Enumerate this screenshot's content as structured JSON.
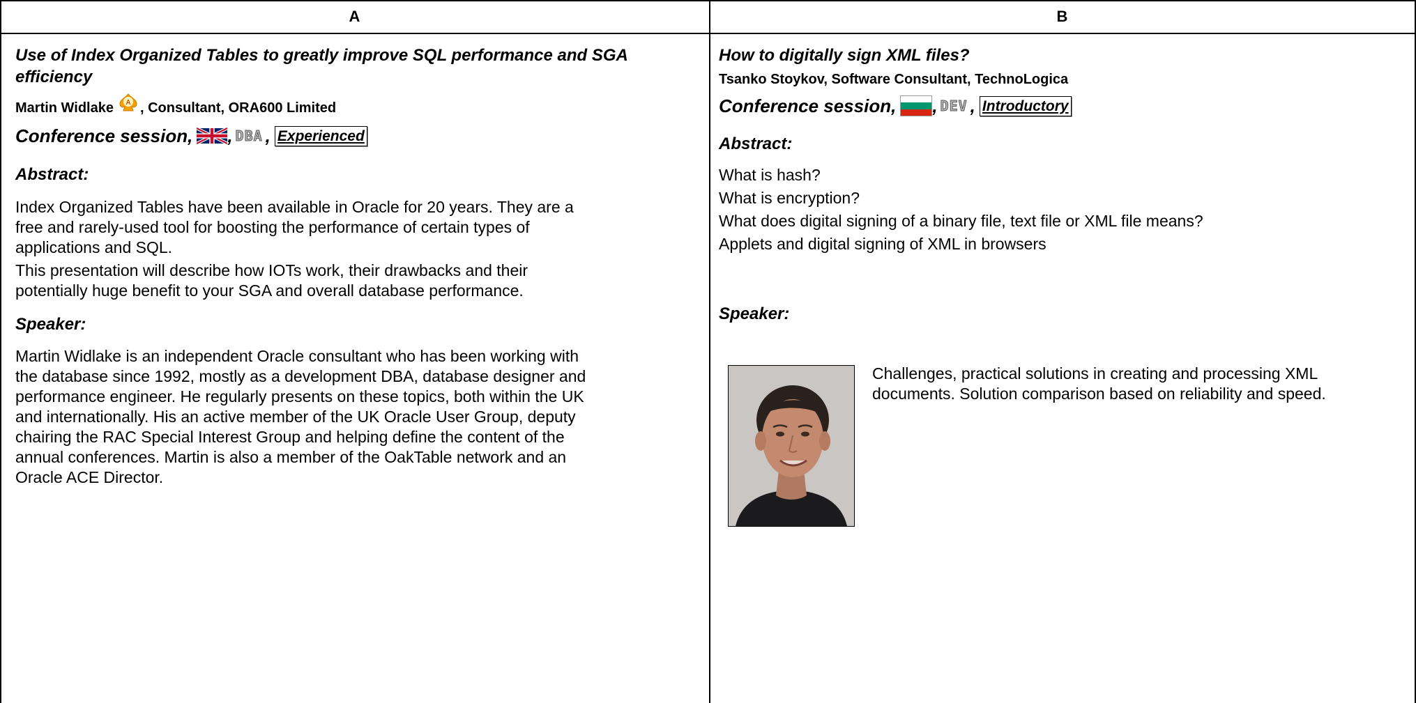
{
  "columns": {
    "a_header": "A",
    "b_header": "B"
  },
  "session_a": {
    "title_line1": "Use of Index Organized Tables to greatly improve SQL performance and SGA",
    "title_line2": "efficiency",
    "speaker_name": "Martin Widlake",
    "speaker_role": ", Consultant, ORA600 Limited",
    "ace_badge_letter": "A",
    "session_label": "Conference session,",
    "flag_icon": "uk-flag-icon",
    "track_tag": "DBA",
    "level": "Experienced",
    "abstract_heading": "Abstract:",
    "abstract_lines": [
      "Index Organized Tables have been available in Oracle for 20 years. They are a",
      "free and rarely-used tool for boosting the performance of certain types of",
      "applications and SQL.",
      "This presentation will describe how IOTs work, their drawbacks and their",
      "potentially huge benefit to your SGA and overall database performance."
    ],
    "speaker_heading": "Speaker:",
    "bio_lines": [
      "Martin Widlake is an independent Oracle consultant who has been working with",
      "the database since 1992, mostly as a development DBA, database designer and",
      "performance engineer. He regularly presents on these topics, both within the UK",
      "and internationally. His an active member of the UK Oracle User Group, deputy",
      "chairing the RAC Special Interest Group and helping define the content of the",
      "annual conferences. Martin is also a member of the OakTable network and an",
      "Oracle ACE Director."
    ]
  },
  "session_b": {
    "title": "How to digitally sign XML files?",
    "speaker_line": "Tsanko Stoykov, Software Consultant, TechnoLogica",
    "session_label": "Conference session,",
    "flag_icon": "bulgaria-flag-icon",
    "track_tag": "DEV",
    "level": "Introductory",
    "abstract_heading": "Abstract:",
    "abstract_lines": [
      "What is hash?",
      "What is encryption?",
      "What does digital signing of a binary file, text file or XML file means?",
      "Applets and digital signing of XML in browsers"
    ],
    "speaker_heading": "Speaker:",
    "bio_lines": [
      "Challenges, practical solutions in creating and processing XML",
      "documents. Solution comparison based on reliability and speed."
    ]
  }
}
